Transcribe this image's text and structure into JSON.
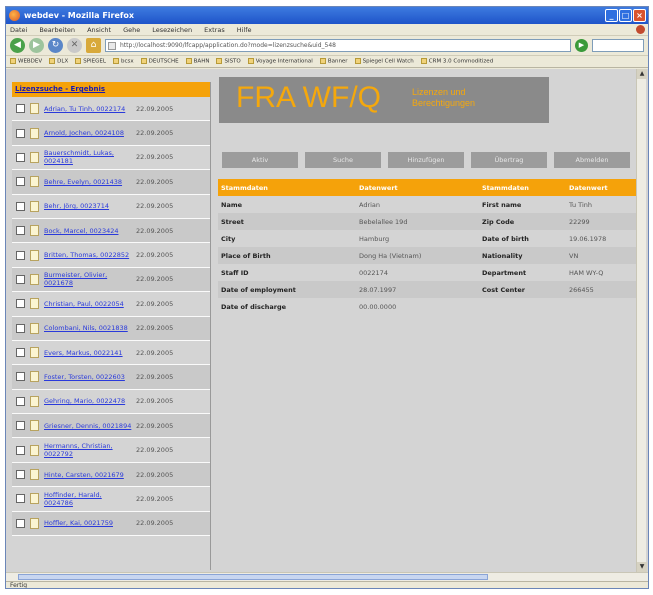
{
  "window": {
    "title": "webdev - Mozilla Firefox",
    "menu": [
      "Datei",
      "Bearbeiten",
      "Ansicht",
      "Gehe",
      "Lesezeichen",
      "Extras",
      "Hilfe"
    ],
    "url": "http://localhost:9090/lfcapp/application.do?mode=lizenzsuche&uid_548",
    "bookmarks": [
      "WEBDEV",
      "DLX",
      "SPIEGEL",
      "bcsx",
      "DEUTSCHE",
      "BAHN",
      "SISTO",
      "Voyage International",
      "Banner",
      "Spiegel Cell Watch",
      "CRM 3.0 Commoditized"
    ],
    "status": "Fertig"
  },
  "sidebar": {
    "header": "Lizenzsuche - Ergebnis",
    "rows": [
      {
        "name": "Adrian, Tu Tinh, 0022174",
        "date": "22.09.2005"
      },
      {
        "name": "Arnold, Jochen, 0024108",
        "date": "22.09.2005"
      },
      {
        "name": "Bauerschmidt, Lukas, 0024181",
        "date": "22.09.2005"
      },
      {
        "name": "Behre, Evelyn, 0021438",
        "date": "22.09.2005"
      },
      {
        "name": "Behr, Jörg, 0023714",
        "date": "22.09.2005"
      },
      {
        "name": "Bock, Marcel, 0023424",
        "date": "22.09.2005"
      },
      {
        "name": "Britten, Thomas, 0022852",
        "date": "22.09.2005"
      },
      {
        "name": "Burmeister, Olivier, 0021678",
        "date": "22.09.2005"
      },
      {
        "name": "Christian, Paul, 0022054",
        "date": "22.09.2005"
      },
      {
        "name": "Colombani, Nils, 0021838",
        "date": "22.09.2005"
      },
      {
        "name": "Evers, Markus, 0022141",
        "date": "22.09.2005"
      },
      {
        "name": "Foster, Torsten, 0022603",
        "date": "22.09.2005"
      },
      {
        "name": "Gehring, Mario, 0022478",
        "date": "22.09.2005"
      },
      {
        "name": "Griesner, Dennis, 0021894",
        "date": "22.09.2005"
      },
      {
        "name": "Hermanns, Christian, 0022792",
        "date": "22.09.2005"
      },
      {
        "name": "Hinte, Carsten, 0021679",
        "date": "22.09.2005"
      },
      {
        "name": "Hoffinder, Harald, 0024786",
        "date": "22.09.2005"
      },
      {
        "name": "Hoffler, Kai, 0021759",
        "date": "22.09.2005"
      }
    ]
  },
  "logo": {
    "big": "FRA WF/Q",
    "small_line1": "Lizenzen und",
    "small_line2": "Berechtigungen"
  },
  "buttons": [
    "Aktiv",
    "Suche",
    "Hinzufügen",
    "Übertrag",
    "Abmelden"
  ],
  "detail": {
    "header": [
      "Stammdaten",
      "Datenwert",
      "Stammdaten",
      "Datenwert"
    ],
    "rows": [
      {
        "l1": "Name",
        "v1": "Adrian",
        "l2": "First name",
        "v2": "Tu Tinh"
      },
      {
        "l1": "Street",
        "v1": "Bebelallee 19d",
        "l2": "Zip Code",
        "v2": "22299"
      },
      {
        "l1": "City",
        "v1": "Hamburg",
        "l2": "Date of birth",
        "v2": "19.06.1978"
      },
      {
        "l1": "Place of Birth",
        "v1": "Dong Ha (Vietnam)",
        "l2": "Nationality",
        "v2": "VN"
      },
      {
        "l1": "Staff ID",
        "v1": "0022174",
        "l2": "Department",
        "v2": "HAM WY-Q"
      },
      {
        "l1": "Date of employment",
        "v1": "28.07.1997",
        "l2": "Cost Center",
        "v2": "266455"
      },
      {
        "l1": "Date of discharge",
        "v1": "00.00.0000",
        "l2": "",
        "v2": ""
      }
    ]
  }
}
